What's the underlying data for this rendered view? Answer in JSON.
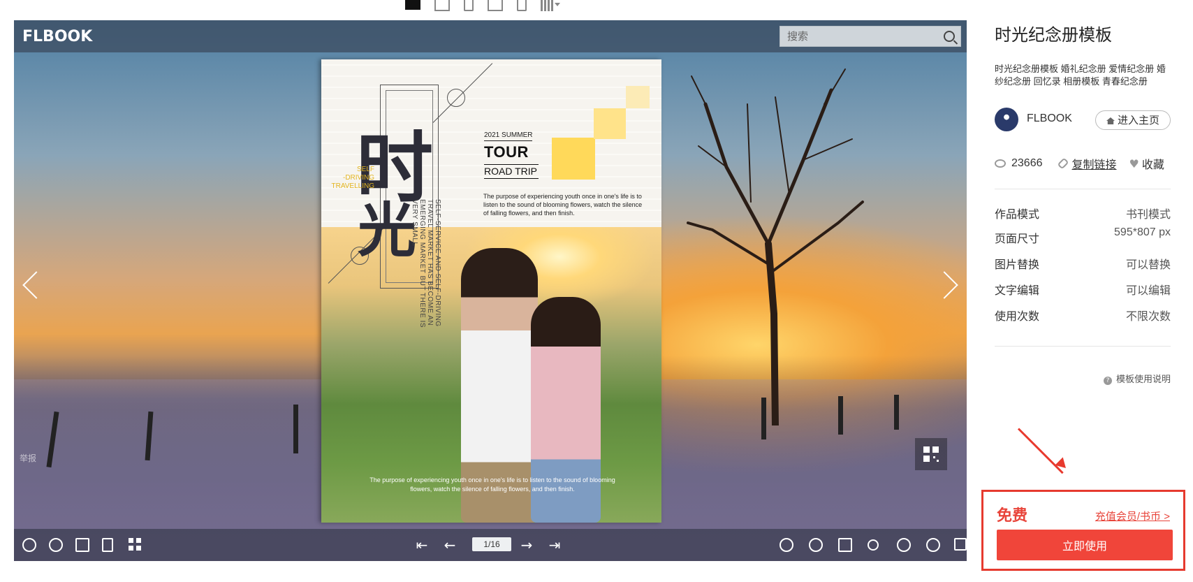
{
  "viewer": {
    "logo": "FLBOOK",
    "search_placeholder": "搜索",
    "report_label": "举报",
    "page_indicator": "1/16"
  },
  "page_content": {
    "big_char_1": "时",
    "big_char_2": "光",
    "self_driving": "SELF\n-DRIVING\nTRAVELLING",
    "vertical_text": "SELF-SERVICE AND SELF-DRIVING TRAVEL MARKET HAS BECOME AN EMERGING MARKET BUT THERE IS VERY SMALL",
    "summer": "2021 SUMMER",
    "tour": "TOUR",
    "road_trip": "ROAD TRIP",
    "purpose_top": "The purpose of experiencing youth once in one's life is to listen to the sound of blooming flowers, watch the silence of falling flowers, and then finish.",
    "purpose_bottom": "The purpose of experiencing youth once in one's life is to listen to the sound of blooming flowers, watch the silence of falling flowers, and then finish."
  },
  "sidebar": {
    "title": "时光纪念册模板",
    "tags": "时光纪念册模板 婚礼纪念册 爱情纪念册 婚纱纪念册 回忆录 相册模板 青春纪念册",
    "author": "FLBOOK",
    "home_button": "进入主页",
    "views": "23666",
    "copy_link": "复制链接",
    "favorite": "收藏",
    "info": [
      {
        "key": "作品模式",
        "value": "书刊模式"
      },
      {
        "key": "页面尺寸",
        "value": "595*807 px"
      },
      {
        "key": "图片替换",
        "value": "可以替换"
      },
      {
        "key": "文字编辑",
        "value": "可以编辑"
      },
      {
        "key": "使用次数",
        "value": "不限次数"
      }
    ],
    "help": "模板使用说明",
    "help_glyph": "?"
  },
  "purchase": {
    "price": "免费",
    "member_link": "充值会员/书币 >",
    "use_button": "立即使用"
  },
  "icons": {
    "accent": "#f0453a"
  }
}
